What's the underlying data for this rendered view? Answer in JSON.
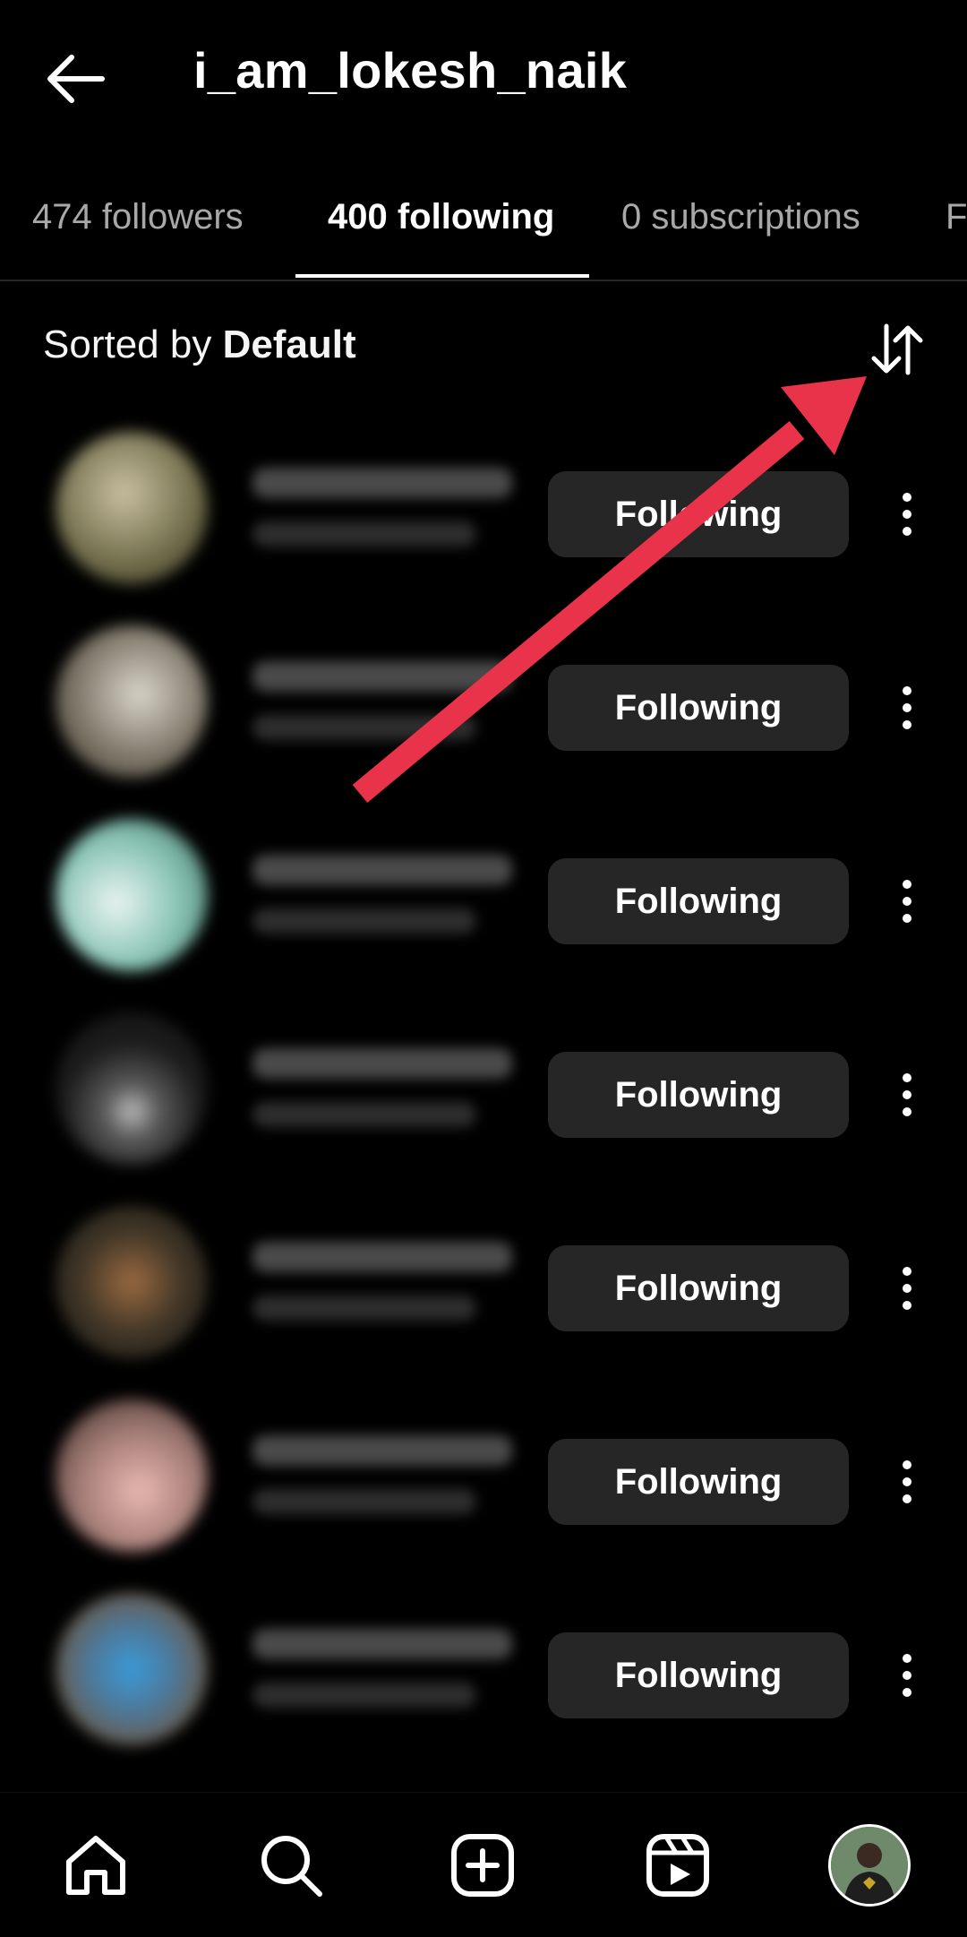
{
  "header": {
    "title": "i_am_lokesh_naik",
    "back_icon": "arrow-left-icon"
  },
  "tabs": [
    {
      "label": "474 followers",
      "active": false
    },
    {
      "label": "400 following",
      "active": true
    },
    {
      "label": "0 subscriptions",
      "active": false
    },
    {
      "label": "F",
      "active": false
    }
  ],
  "sort": {
    "prefix": "Sorted by ",
    "value": "Default",
    "icon": "sort-arrows-icon"
  },
  "following_list": [
    {
      "button_label": "Following",
      "more_icon": "more-vertical-icon",
      "avatar_color": "#8a8a60"
    },
    {
      "button_label": "Following",
      "more_icon": "more-vertical-icon",
      "avatar_color": "#7c7668"
    },
    {
      "button_label": "Following",
      "more_icon": "more-vertical-icon",
      "avatar_color": "#8ac4b6"
    },
    {
      "button_label": "Following",
      "more_icon": "more-vertical-icon",
      "avatar_color": "#2a2a2a"
    },
    {
      "button_label": "Following",
      "more_icon": "more-vertical-icon",
      "avatar_color": "#3e3426"
    },
    {
      "button_label": "Following",
      "more_icon": "more-vertical-icon",
      "avatar_color": "#a8807a"
    },
    {
      "button_label": "Following",
      "more_icon": "more-vertical-icon",
      "avatar_color": "#4e7898"
    }
  ],
  "bottom_nav": [
    {
      "icon": "home-icon"
    },
    {
      "icon": "search-icon"
    },
    {
      "icon": "create-post-icon"
    },
    {
      "icon": "reels-icon"
    },
    {
      "icon": "profile-avatar-icon"
    }
  ],
  "colors": {
    "background": "#000000",
    "button_bg": "#262626",
    "inactive_tab": "#a8a8a8",
    "annotation": "#e8334a"
  }
}
